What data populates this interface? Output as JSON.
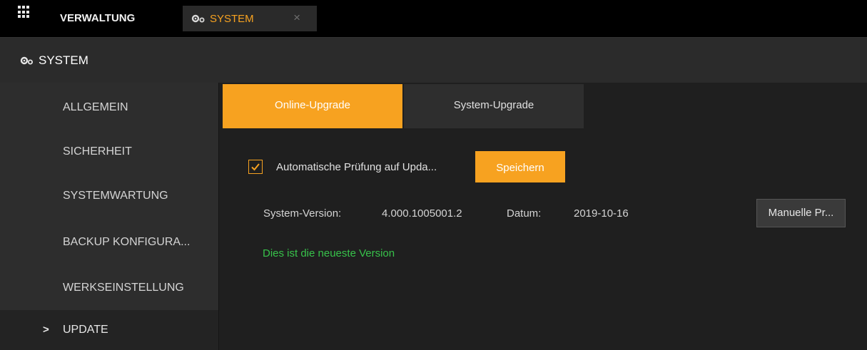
{
  "topbar": {
    "apps_icon": "apps-grid-icon",
    "tab_verwaltung": "VERWALTUNG",
    "tab_system": "SYSTEM",
    "tab_close": "×"
  },
  "header": {
    "title": "SYSTEM",
    "icon": "gears-icon"
  },
  "sidebar": {
    "items": [
      {
        "label": "ALLGEMEIN"
      },
      {
        "label": "SICHERHEIT"
      },
      {
        "label": "SYSTEMWARTUNG"
      },
      {
        "label": "BACKUP KONFIGURA..."
      },
      {
        "label": "WERKSEINSTELLUNG"
      },
      {
        "label": "UPDATE",
        "active": true
      }
    ],
    "active_marker": ">"
  },
  "main": {
    "tabs": [
      {
        "label": "Online-Upgrade",
        "active": true
      },
      {
        "label": "System-Upgrade",
        "active": false
      }
    ],
    "auto_check": {
      "label": "Automatische Prüfung auf Upda...",
      "checked": true
    },
    "save_label": "Speichern",
    "version_label": "System-Version:",
    "version_value": "4.000.1005001.2",
    "date_label": "Datum:",
    "date_value": "2019-10-16",
    "manual_label": "Manuelle Pr...",
    "status_text": "Dies ist die neueste Version"
  },
  "colors": {
    "accent": "#f7a220",
    "ok": "#37c24a"
  }
}
